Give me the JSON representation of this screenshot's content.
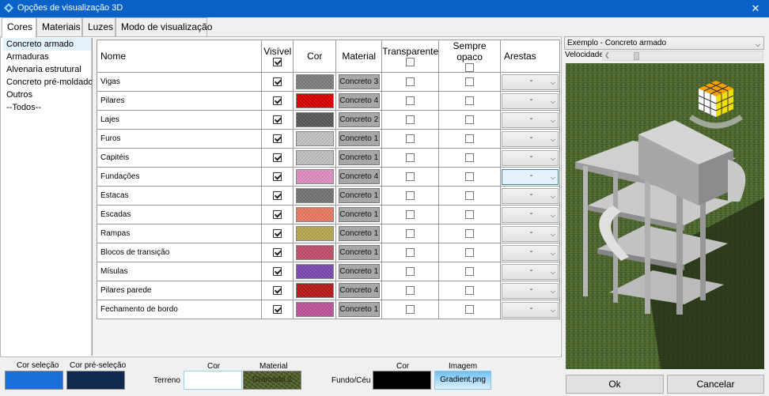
{
  "window": {
    "title": "Opções de visualização 3D",
    "close_glyph": "✕"
  },
  "tabs": [
    {
      "label": "Cores",
      "active": true
    },
    {
      "label": "Materiais"
    },
    {
      "label": "Luzes"
    },
    {
      "label": "Modo de visualização"
    }
  ],
  "categories": [
    {
      "label": "Concreto armado",
      "selected": true
    },
    {
      "label": "Armaduras"
    },
    {
      "label": "Alvenaria estrutural"
    },
    {
      "label": "Concreto pré-moldado"
    },
    {
      "label": "Outros"
    },
    {
      "label": "--Todos--"
    }
  ],
  "grid": {
    "headers": {
      "nome": "Nome",
      "visivel": "Visível",
      "cor": "Cor",
      "material": "Material",
      "transparente": "Transparente",
      "sempre_opaco": "Sempre opaco",
      "arestas": "Arestas"
    },
    "rows": [
      {
        "name": "Vigas",
        "visible": true,
        "color": "#7c7c7c",
        "material": "Concreto 3",
        "transparent": false,
        "opaque": false,
        "edges": "-"
      },
      {
        "name": "Pilares",
        "visible": true,
        "color": "#d80000",
        "material": "Concreto 4",
        "transparent": false,
        "opaque": false,
        "edges": "-"
      },
      {
        "name": "Lajes",
        "visible": true,
        "color": "#575757",
        "material": "Concreto 2",
        "transparent": false,
        "opaque": false,
        "edges": "-"
      },
      {
        "name": "Furos",
        "visible": true,
        "color": "#c3c3c3",
        "material": "Concreto 1",
        "transparent": false,
        "opaque": false,
        "edges": "-"
      },
      {
        "name": "Capitéis",
        "visible": true,
        "color": "#c0c0c0",
        "material": "Concreto 1",
        "transparent": false,
        "opaque": false,
        "edges": "-"
      },
      {
        "name": "Fundações",
        "visible": true,
        "color": "#e08ec2",
        "material": "Concreto 4",
        "transparent": false,
        "opaque": false,
        "edges": "-",
        "edges_focused": true
      },
      {
        "name": "Estacas",
        "visible": true,
        "color": "#737373",
        "material": "Concreto 1",
        "transparent": false,
        "opaque": false,
        "edges": "-"
      },
      {
        "name": "Escadas",
        "visible": true,
        "color": "#e97a5e",
        "material": "Concreto 1",
        "transparent": false,
        "opaque": false,
        "edges": "-"
      },
      {
        "name": "Rampas",
        "visible": true,
        "color": "#b8a852",
        "material": "Concreto 1",
        "transparent": false,
        "opaque": false,
        "edges": "-"
      },
      {
        "name": "Blocos de transição",
        "visible": true,
        "color": "#c34c69",
        "material": "Concreto 1",
        "transparent": false,
        "opaque": false,
        "edges": "-"
      },
      {
        "name": "Mísulas",
        "visible": true,
        "color": "#7a48b2",
        "material": "Concreto 1",
        "transparent": false,
        "opaque": false,
        "edges": "-"
      },
      {
        "name": "Pilares parede",
        "visible": true,
        "color": "#b81717",
        "material": "Concreto 4",
        "transparent": false,
        "opaque": false,
        "edges": "-"
      },
      {
        "name": "Fechamento de bordo",
        "visible": true,
        "color": "#bd529a",
        "material": "Concreto 1",
        "transparent": false,
        "opaque": false,
        "edges": "-"
      }
    ]
  },
  "preview": {
    "example_label": "Exemplo - Concreto armado",
    "speed_label": "Velocidade",
    "speed_value": 0.16
  },
  "buttons": {
    "ok": "Ok",
    "cancel": "Cancelar"
  },
  "bottom": {
    "selection_color_label": "Cor seleção",
    "preselection_color_label": "Cor pré-seleção",
    "terrain_label": "Terreno",
    "terrain_color_label": "Cor",
    "terrain_material_label": "Material",
    "terrain_material_value": "Gramado 2",
    "background_label": "Fundo/Céu",
    "background_color_label": "Cor",
    "background_image_label": "Imagem",
    "background_image_value": "Gradient.png",
    "selection_color": "#1a6fd8",
    "preselection_color": "#11294e",
    "terrain_color": "#ffffff",
    "background_color": "#000000"
  }
}
